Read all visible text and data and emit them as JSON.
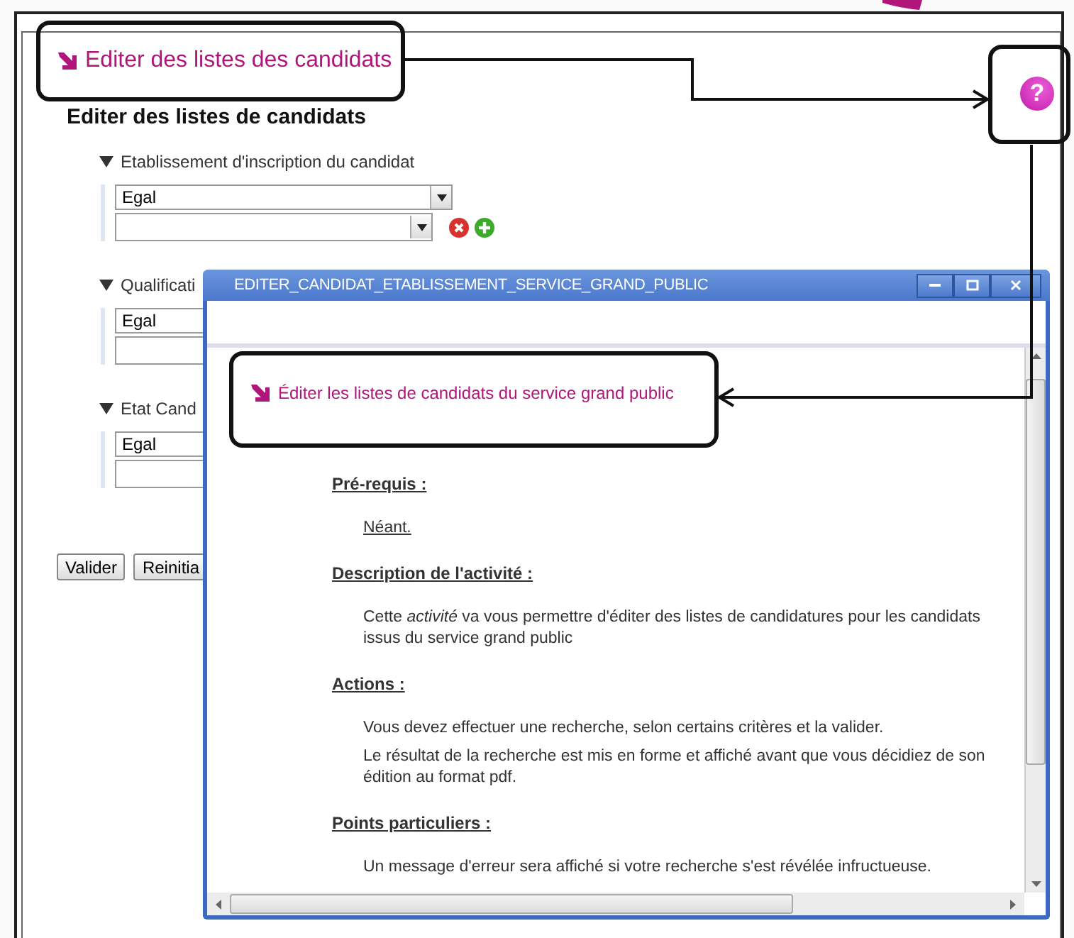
{
  "page": {
    "header_link": "Editer des listes des candidats",
    "heading": "Editer des listes de candidats",
    "criteria": [
      {
        "label": "Etablissement d'inscription du candidat",
        "expanded": true,
        "operator": "Egal",
        "row_buttons": true
      },
      {
        "label": "Qualificati",
        "expanded": true,
        "operator": "Egal",
        "row_buttons": false
      },
      {
        "label": "Etat Cand",
        "expanded": true,
        "operator": "Egal",
        "row_buttons": false
      }
    ],
    "buttons": [
      "Valider",
      "Reinitia"
    ]
  },
  "help_button": {
    "glyph": "?"
  },
  "help_window": {
    "title": "EDITER_CANDIDAT_ETABLISSEMENT_SERVICE_GRAND_PUBLIC",
    "link": "Éditer les listes de candidats du service grand public",
    "sections": [
      {
        "heading": "Pré-requis :",
        "paragraphs": [
          {
            "text": "Néant.",
            "underlined": true
          }
        ]
      },
      {
        "heading": "Description de l'activité :",
        "paragraphs": [
          {
            "text": "Cette  *activité* va vous permettre d'éditer des listes de candidatures pour les candidats issus du service grand public",
            "underlined": false
          }
        ]
      },
      {
        "heading": "Actions :",
        "paragraphs": [
          {
            "text": "Vous devez effectuer une recherche, selon certains critères et la valider.",
            "underlined": false
          },
          {
            "text": "Le résultat de la recherche est mis en forme et affiché avant que vous décidiez de son édition au format pdf.",
            "underlined": false
          }
        ]
      },
      {
        "heading": "Points particuliers :",
        "paragraphs": [
          {
            "text": "Un message d'erreur sera affiché si votre recherche s'est révélée infructueuse.",
            "underlined": false
          }
        ]
      }
    ]
  }
}
